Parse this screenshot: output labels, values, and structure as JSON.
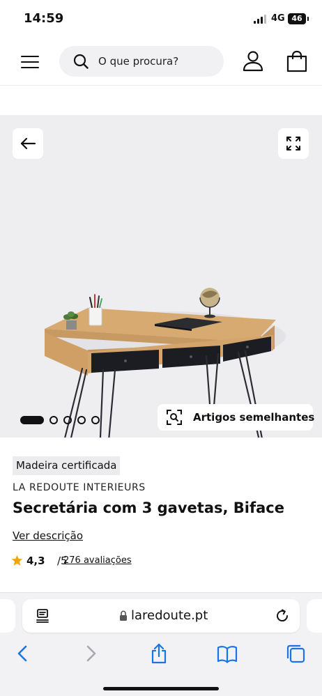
{
  "status_bar": {
    "time": "14:59",
    "network": "4G",
    "battery": "46"
  },
  "header": {
    "menu_icon": "hamburger-menu-icon",
    "search_placeholder": "O que procura?",
    "account_icon": "user-icon",
    "bag_icon": "shopping-bag-icon"
  },
  "carousel": {
    "image_count": 5,
    "active_index": 0,
    "similar_label": "Artigos semelhantes",
    "back_icon": "arrow-left-icon",
    "expand_icon": "expand-icon"
  },
  "product": {
    "badge": "Madeira certificada",
    "brand": "LA REDOUTE INTERIEURS",
    "title": "Secretária com 3 gavetas, Biface",
    "description_link": "Ver descrição",
    "rating": "4,3",
    "rating_max": "/5",
    "review_count": "276 avaliações"
  },
  "safari": {
    "url": "laredoute.pt",
    "toolbar_icons": [
      "back-icon",
      "forward-icon",
      "share-icon",
      "bookmarks-icon",
      "tabs-icon"
    ]
  },
  "colors": {
    "accent": "#1a74e8",
    "star": "#f0a500",
    "image_background": "#eeeef1",
    "text": "#111111"
  }
}
